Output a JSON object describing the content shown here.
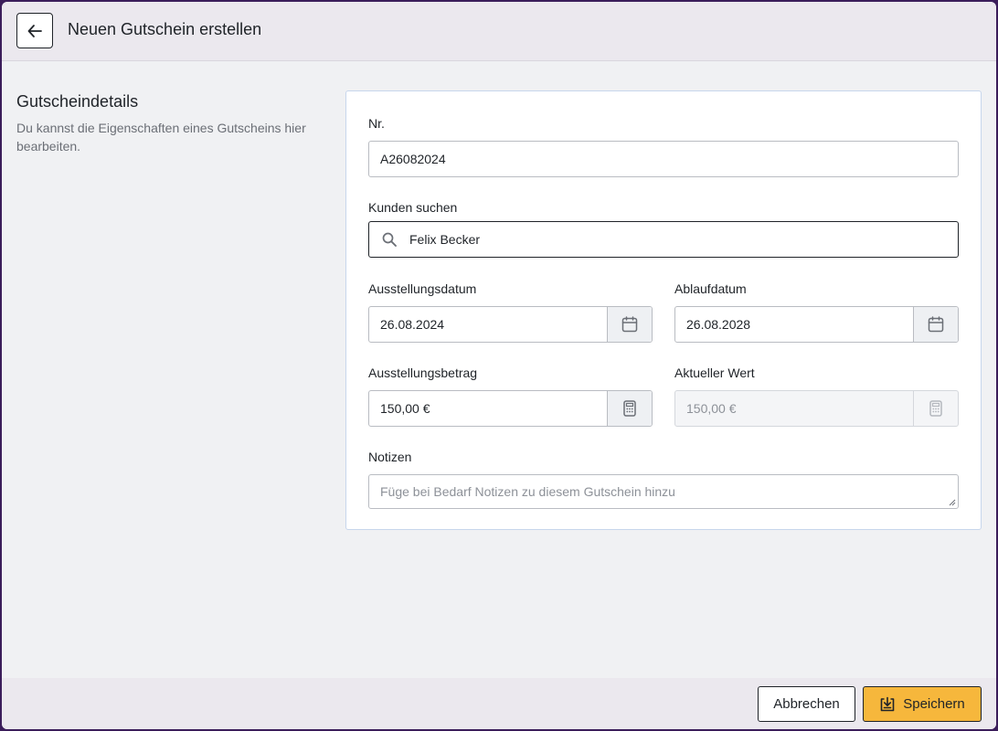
{
  "header": {
    "title": "Neuen Gutschein erstellen",
    "back_icon": "arrow-left-icon"
  },
  "section": {
    "title": "Gutscheindetails",
    "description": "Du kannst die Eigenschaften eines Gutscheins hier bearbeiten."
  },
  "form": {
    "number": {
      "label": "Nr.",
      "value": "A26082024"
    },
    "customer": {
      "label": "Kunden suchen",
      "value": "Felix Becker",
      "icon": "search-icon"
    },
    "issue_date": {
      "label": "Ausstellungsdatum",
      "value": "26.08.2024",
      "icon": "calendar-icon"
    },
    "expiry_date": {
      "label": "Ablaufdatum",
      "value": "26.08.2028",
      "icon": "calendar-icon"
    },
    "issue_amount": {
      "label": "Ausstellungsbetrag",
      "value": "150,00 €",
      "icon": "calculator-icon"
    },
    "current_value": {
      "label": "Aktueller Wert",
      "value": "150,00 €",
      "icon": "calculator-icon",
      "disabled": true
    },
    "notes": {
      "label": "Notizen",
      "placeholder": "Füge bei Bedarf Notizen zu diesem Gutschein hinzu"
    }
  },
  "footer": {
    "cancel_label": "Abbrechen",
    "save_label": "Speichern",
    "save_icon": "save-tray-icon"
  },
  "colors": {
    "accent": "#f6b73c",
    "frame": "#3b1d5a",
    "card_border": "#c7d6ec"
  }
}
